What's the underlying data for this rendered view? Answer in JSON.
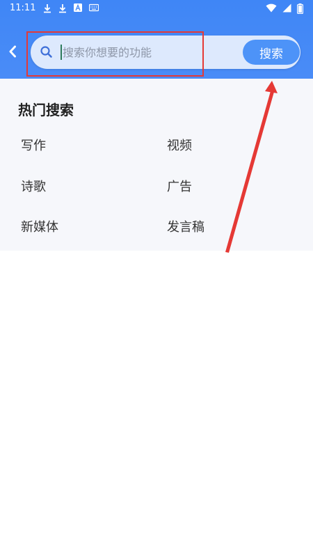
{
  "status_bar": {
    "time": "11:11"
  },
  "header": {
    "back_icon": "chevron-left-icon",
    "search": {
      "placeholder": "搜索你想要的功能",
      "value": "",
      "button_label": "搜索",
      "icon": "search-icon"
    }
  },
  "hot_search": {
    "title": "热门搜索",
    "items": [
      "写作",
      "视频",
      "诗歌",
      "广告",
      "新媒体",
      "发言稿"
    ]
  },
  "colors": {
    "header_bg": "#4a8cf7",
    "search_button": "#4d93f8",
    "annotation_red": "#e53935"
  }
}
